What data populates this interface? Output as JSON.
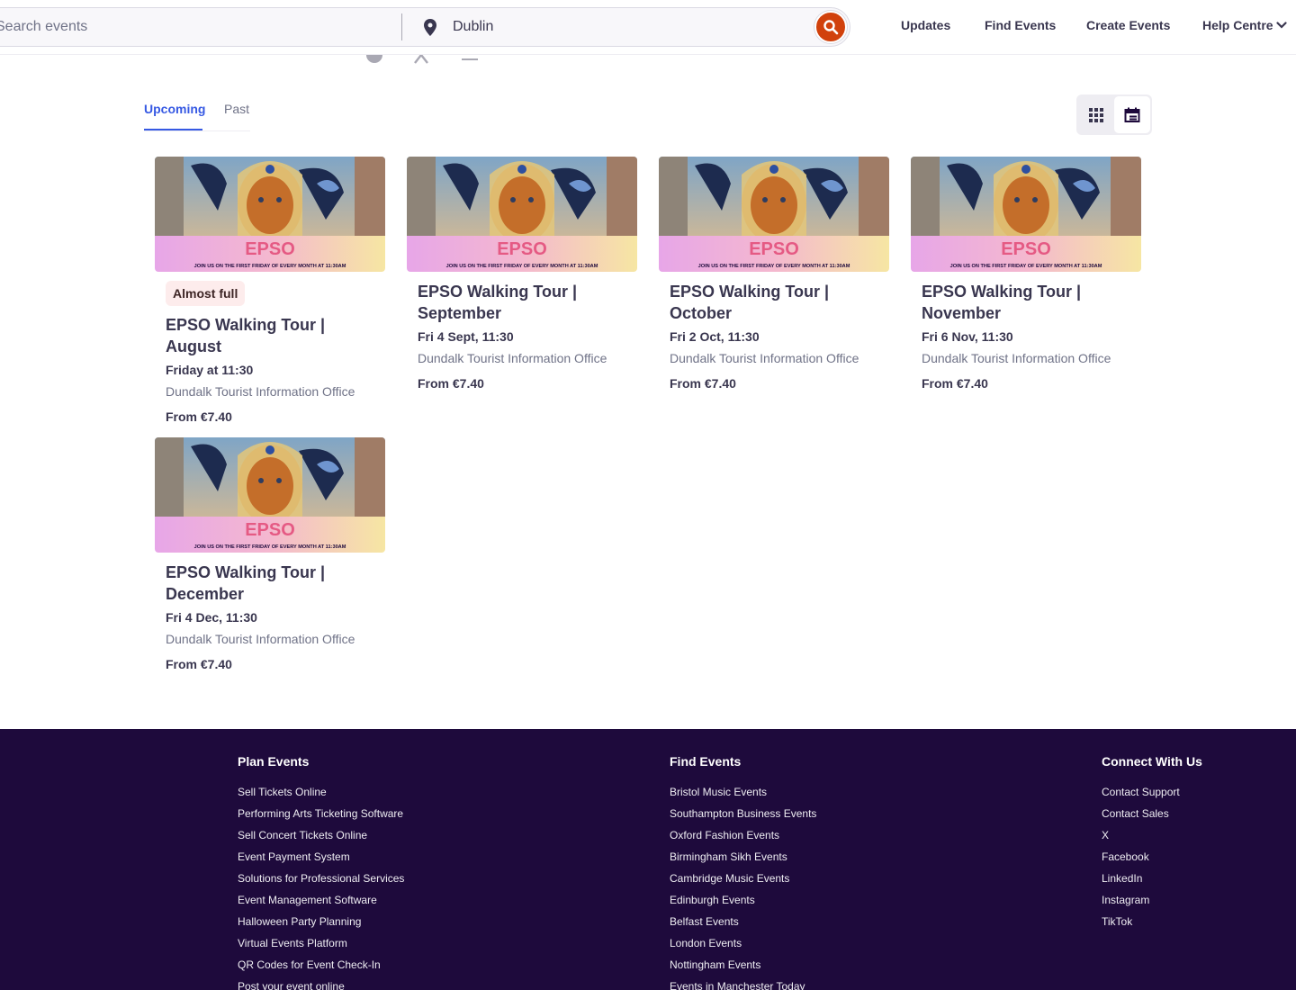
{
  "header": {
    "search_placeholder": "Search events",
    "location": "Dublin",
    "nav": {
      "updates": "Updates",
      "find_events": "Find Events",
      "create_events": "Create Events",
      "help_centre": "Help Centre"
    }
  },
  "tabs": {
    "upcoming": "Upcoming",
    "past": "Past"
  },
  "events": [
    {
      "badge": "Almost full",
      "title": "EPSO Walking Tour | August",
      "date": "Friday at 11:30",
      "venue": "Dundalk Tourist Information Office",
      "price": "From €7.40",
      "image": {
        "logo": "EPSO",
        "tagline": "JOIN US ON THE FIRST FRIDAY OF EVERY MONTH AT 11:30AM"
      }
    },
    {
      "title": "EPSO Walking Tour | September",
      "date": "Fri 4 Sept, 11:30",
      "venue": "Dundalk Tourist Information Office",
      "price": "From €7.40",
      "image": {
        "logo": "EPSO",
        "tagline": "JOIN US ON THE FIRST FRIDAY OF EVERY MONTH AT 11:30AM"
      }
    },
    {
      "title": "EPSO Walking Tour | October",
      "date": "Fri 2 Oct, 11:30",
      "venue": "Dundalk Tourist Information Office",
      "price": "From €7.40",
      "image": {
        "logo": "EPSO",
        "tagline": "JOIN US ON THE FIRST FRIDAY OF EVERY MONTH AT 11:30AM"
      }
    },
    {
      "title": "EPSO Walking Tour | November",
      "date": "Fri 6 Nov, 11:30",
      "venue": "Dundalk Tourist Information Office",
      "price": "From €7.40",
      "image": {
        "logo": "EPSO",
        "tagline": "JOIN US ON THE FIRST FRIDAY OF EVERY MONTH AT 11:30AM"
      }
    },
    {
      "title": "EPSO Walking Tour | December",
      "date": "Fri 4 Dec, 11:30",
      "venue": "Dundalk Tourist Information Office",
      "price": "From €7.40",
      "image": {
        "logo": "EPSO",
        "tagline": "JOIN US ON THE FIRST FRIDAY OF EVERY MONTH AT 11:30AM"
      }
    }
  ],
  "footer": {
    "plan": {
      "heading": "Plan Events",
      "links": [
        "Sell Tickets Online",
        "Performing Arts Ticketing Software",
        "Sell Concert Tickets Online",
        "Event Payment System",
        "Solutions for Professional Services",
        "Event Management Software",
        "Halloween Party Planning",
        "Virtual Events Platform",
        "QR Codes for Event Check-In",
        "Post your event online"
      ]
    },
    "find": {
      "heading": "Find Events",
      "links": [
        "Bristol Music Events",
        "Southampton Business Events",
        "Oxford Fashion Events",
        "Birmingham Sikh Events",
        "Cambridge Music Events",
        "Edinburgh Events",
        "Belfast Events",
        "London Events",
        "Nottingham Events",
        "Events in Manchester Today"
      ]
    },
    "connect": {
      "heading": "Connect With Us",
      "links": [
        "Contact Support",
        "Contact Sales",
        "X",
        "Facebook",
        "LinkedIn",
        "Instagram",
        "TikTok"
      ]
    }
  },
  "colors": {
    "brand_orange": "#d1410c",
    "link_blue": "#3659e3",
    "footer_bg": "#1e0a3c",
    "text_dark": "#39364f",
    "text_muted": "#6f7287",
    "badge_bg": "#fdecec"
  },
  "icons": {
    "search": "search-icon",
    "location": "location-pin-icon",
    "chevron": "chevron-down-icon",
    "grid_view": "grid-view-icon",
    "calendar_view": "calendar-view-icon",
    "share": [
      "facebook-icon",
      "x-icon",
      "email-icon"
    ]
  }
}
